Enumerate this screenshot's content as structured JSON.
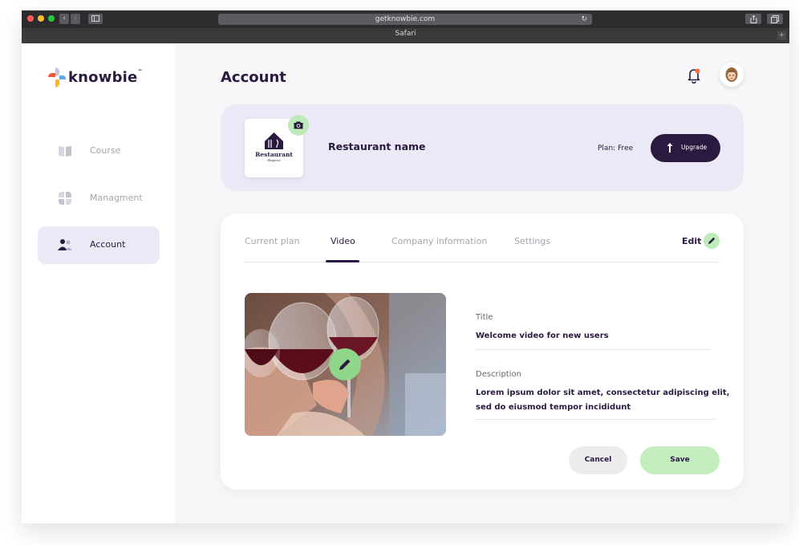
{
  "browser": {
    "url": "getknowbie.com",
    "tab_title": "Safari",
    "back_glyph": "‹",
    "forward_glyph": "›",
    "reload_glyph": "↻",
    "new_tab_glyph": "+"
  },
  "brand": {
    "name": "knowbie",
    "tm": "™"
  },
  "sidebar": {
    "items": [
      {
        "label": "Course",
        "icon": "book-icon",
        "active": false
      },
      {
        "label": "Managment",
        "icon": "grid-icon",
        "active": false
      },
      {
        "label": "Account",
        "icon": "users-icon",
        "active": true
      }
    ]
  },
  "header": {
    "title": "Account"
  },
  "profile": {
    "restaurant_name": "Restaurant name",
    "logo_text": "Restaurant",
    "logo_subtext": "Elegance",
    "plan_text": "Plan: Free",
    "upgrade_label": "Upgrade"
  },
  "tabs": [
    {
      "label": "Current plan",
      "active": false
    },
    {
      "label": "Video",
      "active": true
    },
    {
      "label": "Company information",
      "active": false
    },
    {
      "label": "Settings",
      "active": false
    }
  ],
  "edit_label": "Edit",
  "form": {
    "title_label": "Title",
    "title_value": "Welcome video for new users",
    "description_label": "Description",
    "description_line1": "Lorem ipsum dolor sit amet, consectetur adipiscing elit,",
    "description_line2": "sed do eiusmod tempor incididunt"
  },
  "actions": {
    "cancel": "Cancel",
    "save": "Save"
  },
  "colors": {
    "primary": "#2a1a3f",
    "accent_green": "#bfeab9",
    "card_lavender": "#ebe9f5",
    "notification": "#ff6b3d"
  }
}
